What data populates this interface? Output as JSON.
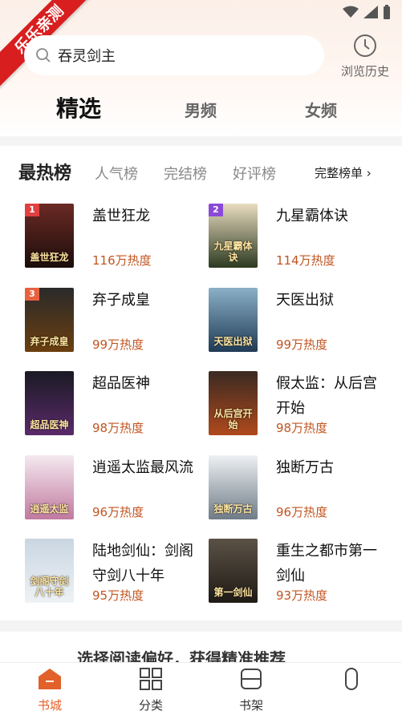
{
  "badge_ribbon": "乐乐亲测",
  "search": {
    "value": "吞灵剑主"
  },
  "history": {
    "label": "浏览历史"
  },
  "tabs": {
    "selected": "精选",
    "male": "男频",
    "female": "女频"
  },
  "ranking": {
    "main": "最热榜",
    "sub": [
      "人气榜",
      "完结榜",
      "好评榜"
    ],
    "full": "完整榜单 ›",
    "books": [
      {
        "rank": "1",
        "title": "盖世狂龙",
        "heat": "116万热度",
        "cover_text": "盖世狂龙",
        "color_top": "#6b2a24",
        "color_bot": "#1c0d0b"
      },
      {
        "rank": "2",
        "title": "九星霸体诀",
        "heat": "114万热度",
        "cover_text": "九星霸体诀",
        "color_top": "#e9dcc0",
        "color_bot": "#2c3a20"
      },
      {
        "rank": "3",
        "title": "弃子成皇",
        "heat": "99万热度",
        "cover_text": "弃子成皇",
        "color_top": "#2a2a2a",
        "color_bot": "#6b3f10"
      },
      {
        "rank": "",
        "title": "天医出狱",
        "heat": "99万热度",
        "cover_text": "天医出狱",
        "color_top": "#8bb0c8",
        "color_bot": "#1f3b56"
      },
      {
        "rank": "",
        "title": "超品医神",
        "heat": "98万热度",
        "cover_text": "超品医神",
        "color_top": "#1a1a24",
        "color_bot": "#5a2a6a"
      },
      {
        "rank": "",
        "title": "假太监：从后宫开始",
        "heat": "98万热度",
        "cover_text": "从后宫开始",
        "color_top": "#3a2a22",
        "color_bot": "#b0491c"
      },
      {
        "rank": "",
        "title": "逍遥太监最风流",
        "heat": "96万热度",
        "cover_text": "逍遥太监",
        "color_top": "#f5e9ef",
        "color_bot": "#c07aa0"
      },
      {
        "rank": "",
        "title": "独断万古",
        "heat": "96万热度",
        "cover_text": "独断万古",
        "color_top": "#eef1f3",
        "color_bot": "#6f7c88"
      },
      {
        "rank": "",
        "title": "陆地剑仙：剑阁守剑八十年",
        "heat": "95万热度",
        "cover_text": "剑阁守剑八十年",
        "color_top": "#c9d6e2",
        "color_bot": "#eef2f5"
      },
      {
        "rank": "",
        "title": "重生之都市第一剑仙",
        "heat": "93万热度",
        "cover_text": "第一剑仙",
        "color_top": "#5b5246",
        "color_bot": "#1f1a15"
      }
    ]
  },
  "bottom_peek": "选择阅读偏好，获得精准推荐",
  "nav": {
    "items": [
      "书城",
      "分类",
      "书架",
      ""
    ]
  },
  "colors": {
    "accent": "#e2612a",
    "heat": "#c15521",
    "ribbon": "#d81e1e",
    "badge1": "#e04040",
    "badge2": "#8a4ad8",
    "badge3": "#e86040"
  }
}
